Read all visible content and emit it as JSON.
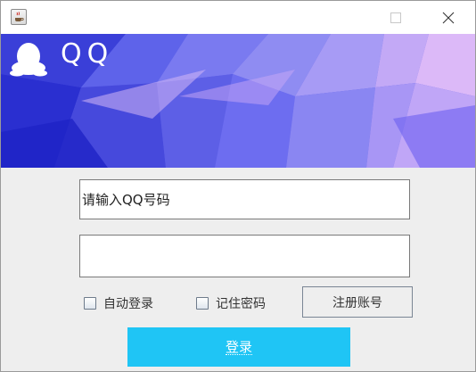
{
  "titlebar": {
    "app_icon": "java-coffee-icon",
    "minimize_icon": "minimize-icon",
    "maximize_icon": "maximize-icon",
    "close_icon": "close-icon"
  },
  "banner": {
    "logo_icon": "qq-penguin-logo",
    "brand_text": "QQ",
    "colors": {
      "base": "#5a5ee8",
      "light": "#c9a7f5",
      "deep": "#2a2fd0"
    }
  },
  "form": {
    "account_value": "请输入QQ号码",
    "password_value": "",
    "auto_login_label": "自动登录",
    "auto_login_checked": false,
    "remember_label": "记住密码",
    "remember_checked": false,
    "register_label": "注册账号",
    "login_label": "登录",
    "login_color": "#1fc5f5"
  }
}
